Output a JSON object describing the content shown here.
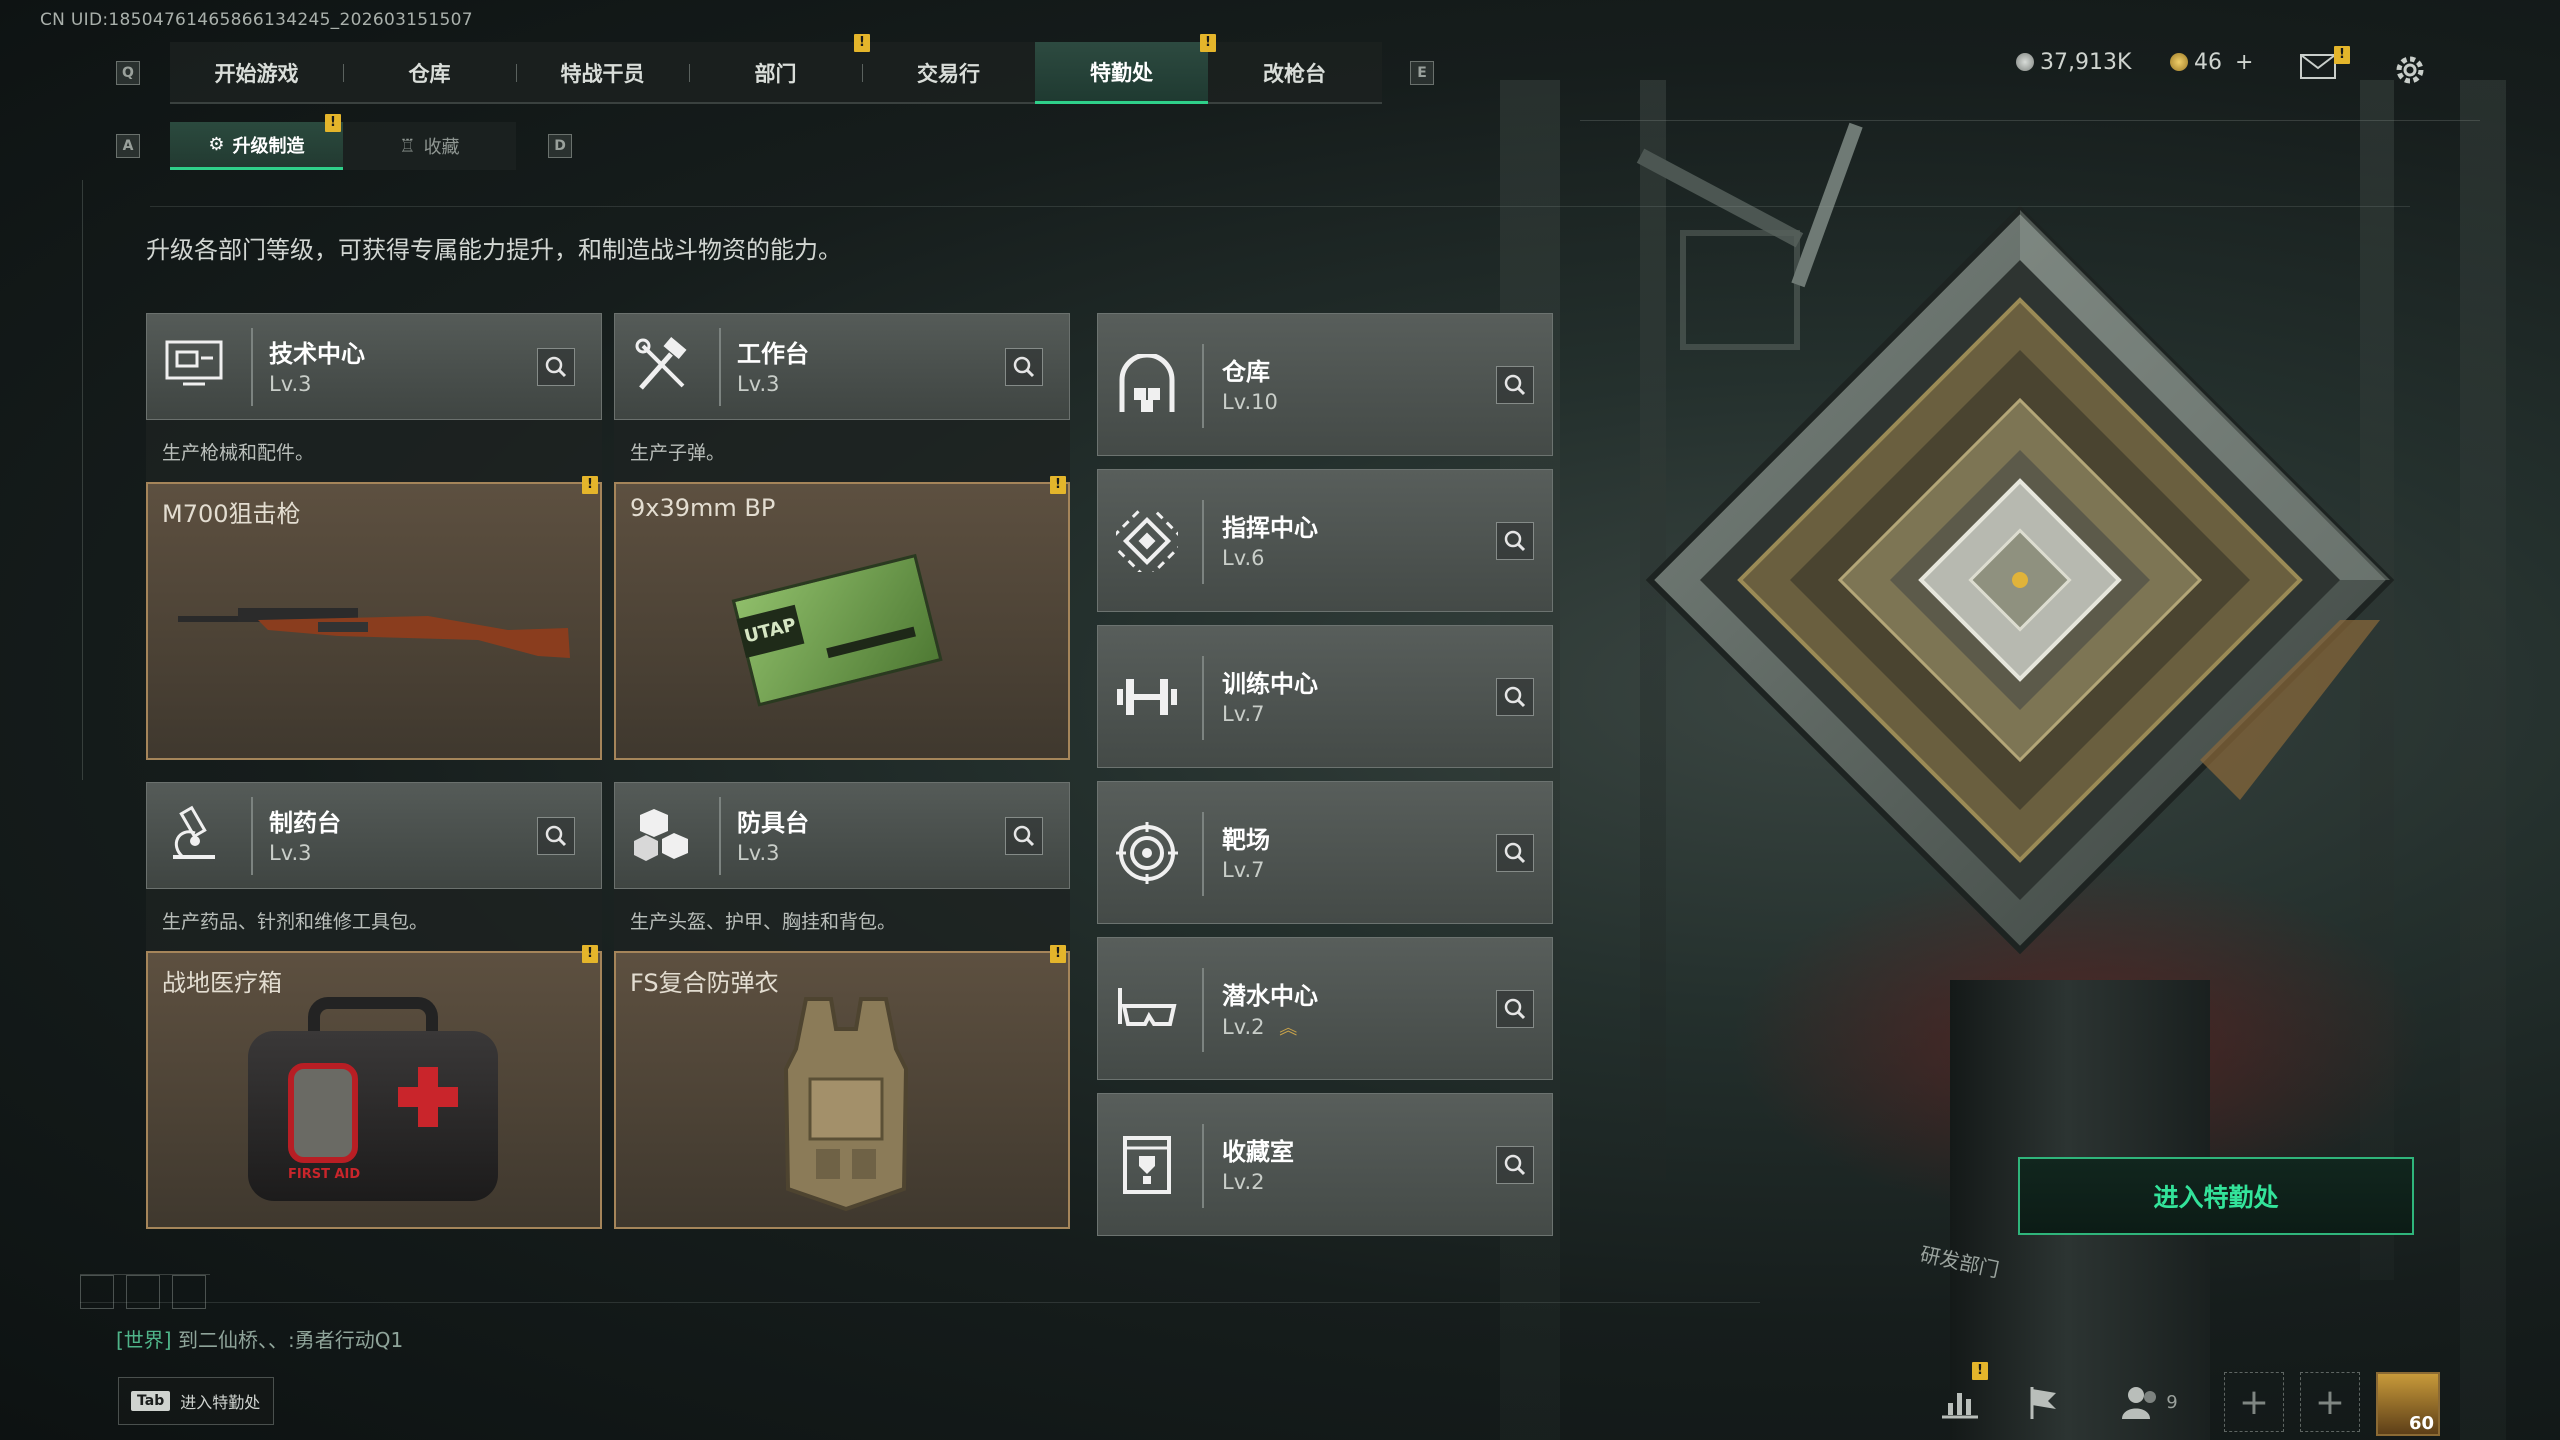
{
  "uid": "CN UID:18504761465866134245_202603151507",
  "nav": {
    "key_left": "Q",
    "key_right": "E",
    "tabs": [
      {
        "label": "开始游戏",
        "alert": false
      },
      {
        "label": "仓库",
        "alert": false
      },
      {
        "label": "特战干员",
        "alert": false
      },
      {
        "label": "部门",
        "alert": true
      },
      {
        "label": "交易行",
        "alert": false
      },
      {
        "label": "特勤处",
        "alert": true,
        "active": true
      },
      {
        "label": "改枪台",
        "alert": false
      }
    ],
    "alert_mark": "!"
  },
  "currency": {
    "coins": "37,913K",
    "bonds": "46",
    "plus": "+"
  },
  "subtabs": {
    "key_left": "A",
    "key_right": "D",
    "items": [
      {
        "label": "升级制造",
        "active": true,
        "alert": true
      },
      {
        "label": "收藏",
        "active": false,
        "alert": false
      }
    ]
  },
  "description": "升级各部门等级，可获得专属能力提升，和制造战斗物资的能力。",
  "production_cards": [
    {
      "name": "技术中心",
      "level": "Lv.3",
      "desc": "生产枪械和配件。",
      "item": "M700狙击枪",
      "icon": "monitor-icon"
    },
    {
      "name": "工作台",
      "level": "Lv.3",
      "desc": "生产子弹。",
      "item": "9x39mm BP",
      "icon": "tools-icon"
    },
    {
      "name": "制药台",
      "level": "Lv.3",
      "desc": "生产药品、针剂和维修工具包。",
      "item": "战地医疗箱",
      "icon": "microscope-icon"
    },
    {
      "name": "防具台",
      "level": "Lv.3",
      "desc": "生产头盔、护甲、胸挂和背包。",
      "item": "FS复合防弹衣",
      "icon": "boxes-icon"
    }
  ],
  "departments": [
    {
      "name": "仓库",
      "level": "Lv.10",
      "icon": "warehouse-icon"
    },
    {
      "name": "指挥中心",
      "level": "Lv.6",
      "icon": "command-icon"
    },
    {
      "name": "训练中心",
      "level": "Lv.7",
      "icon": "dumbbell-icon"
    },
    {
      "name": "靶场",
      "level": "Lv.7",
      "icon": "target-icon"
    },
    {
      "name": "潜水中心",
      "level": "Lv.2",
      "icon": "goggles-icon"
    },
    {
      "name": "收藏室",
      "level": "Lv.2",
      "icon": "trophy-case-icon"
    }
  ],
  "ammo_box_text": "UTAP",
  "medkit_text": "FIRST AID",
  "enter_button": "进入特勤处",
  "scene_sign": "研发部门",
  "chat": {
    "channel": "[世界]",
    "sender": "到二仙桥、、:",
    "message": "勇者行动Q1"
  },
  "tab_hint": {
    "key": "Tab",
    "label": "进入特勤处"
  },
  "friends_count": "9",
  "avatar_level": "60",
  "colors": {
    "accent": "#2fd08a",
    "alert": "#e4b52b",
    "item_border": "#a5855a"
  }
}
